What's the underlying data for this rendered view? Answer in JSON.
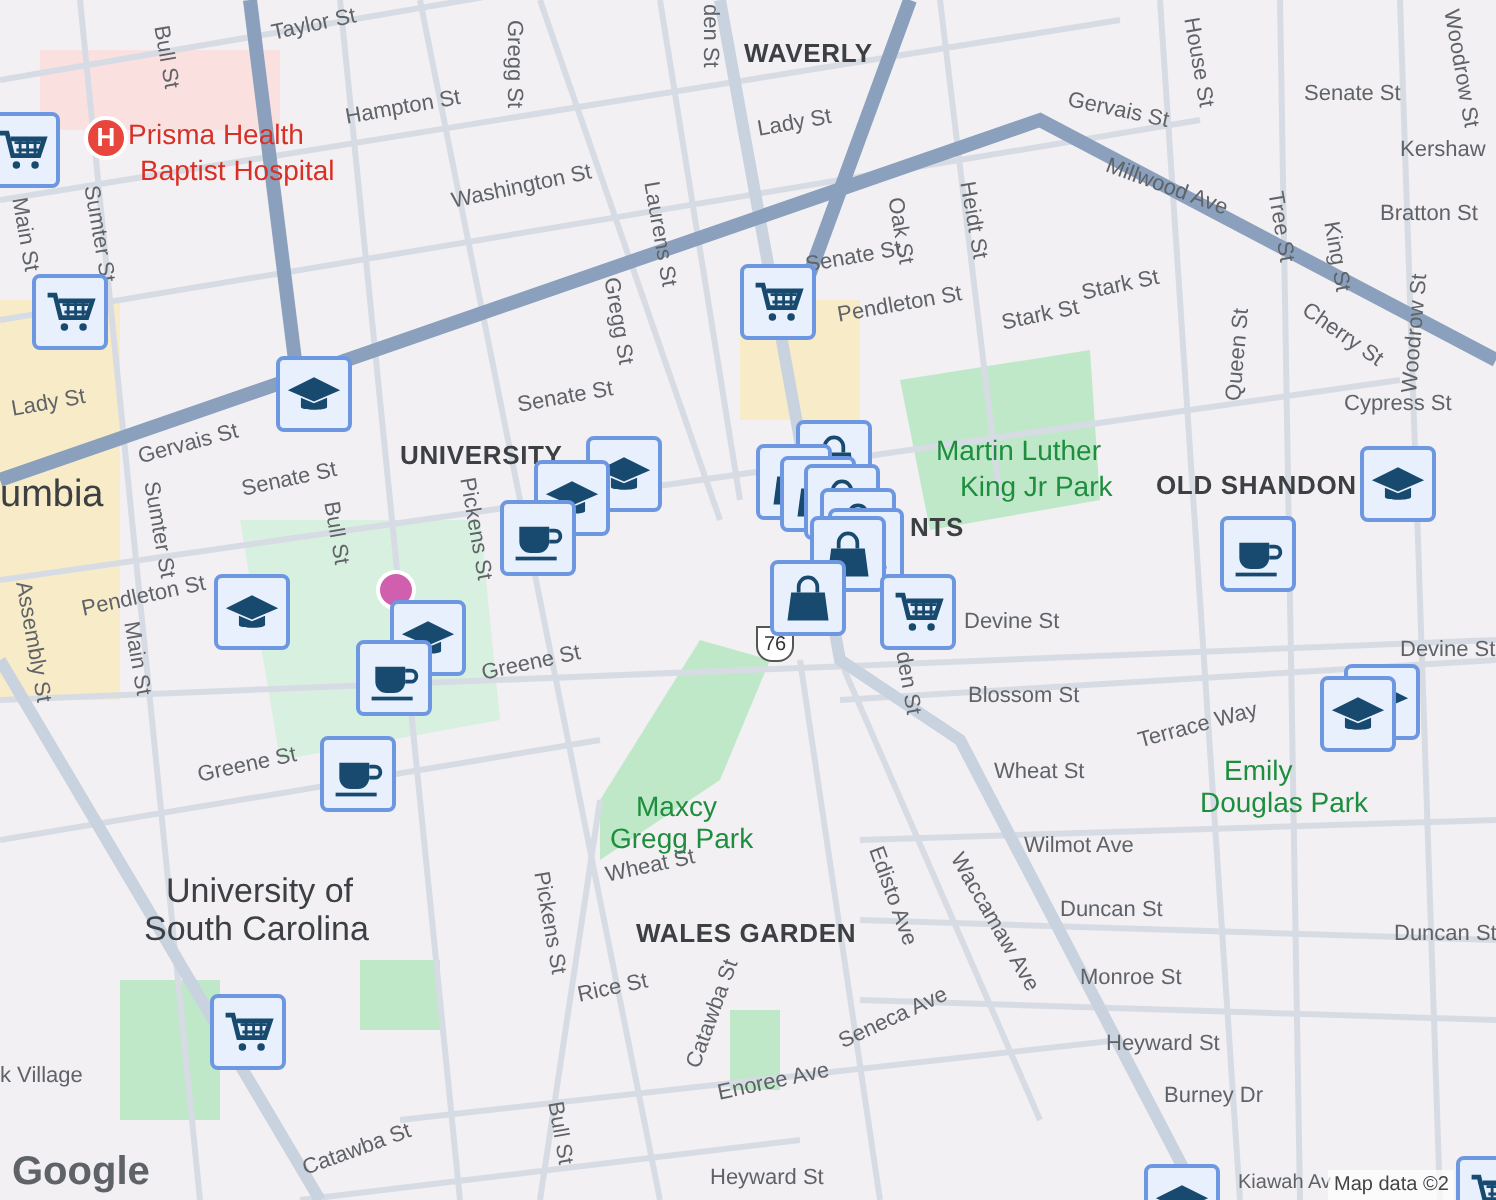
{
  "map": {
    "labels": [
      {
        "text": "Taylor St",
        "kind": "street"
      },
      {
        "text": "Gregg St",
        "kind": "street"
      },
      {
        "text": "Bull St",
        "kind": "street"
      },
      {
        "text": "WAVERLY",
        "kind": "area"
      },
      {
        "text": "den St",
        "kind": "street"
      },
      {
        "text": "Gervais St",
        "kind": "street"
      },
      {
        "text": "Senate St",
        "kind": "street"
      },
      {
        "text": "Woodrow St",
        "kind": "street"
      },
      {
        "text": "Kershaw",
        "kind": "street"
      },
      {
        "text": "Prisma Health",
        "kind": "poi"
      },
      {
        "text": "Baptist Hospital",
        "kind": "poi"
      },
      {
        "text": "Hampton St",
        "kind": "street"
      },
      {
        "text": "Washington St",
        "kind": "street"
      },
      {
        "text": "Lady St",
        "kind": "street"
      },
      {
        "text": "Millwood Ave",
        "kind": "street"
      },
      {
        "text": "Bratton St",
        "kind": "street"
      },
      {
        "text": "Laurens St",
        "kind": "street"
      },
      {
        "text": "Oak St",
        "kind": "street"
      },
      {
        "text": "Heidt St",
        "kind": "street"
      },
      {
        "text": "House St",
        "kind": "street"
      },
      {
        "text": "Tree St",
        "kind": "street"
      },
      {
        "text": "King St",
        "kind": "street"
      },
      {
        "text": "Senate St",
        "kind": "street"
      },
      {
        "text": "Pendleton St",
        "kind": "street"
      },
      {
        "text": "Stark St",
        "kind": "street"
      },
      {
        "text": "Stark St",
        "kind": "street"
      },
      {
        "text": "Cherry St",
        "kind": "street"
      },
      {
        "text": "Gregg St",
        "kind": "street"
      },
      {
        "text": "Main St",
        "kind": "street"
      },
      {
        "text": "Sumter St",
        "kind": "street"
      },
      {
        "text": "Lady St",
        "kind": "street"
      },
      {
        "text": "Gervais St",
        "kind": "street"
      },
      {
        "text": "Senate St",
        "kind": "street"
      },
      {
        "text": "Cypress St",
        "kind": "street"
      },
      {
        "text": "Queen St",
        "kind": "street"
      },
      {
        "text": "Woodrow St",
        "kind": "street"
      },
      {
        "text": "umbia",
        "kind": "city"
      },
      {
        "text": "UNIVERSITY",
        "kind": "area"
      },
      {
        "text": "Martin Luther",
        "kind": "park"
      },
      {
        "text": "King Jr Park",
        "kind": "park"
      },
      {
        "text": "OLD SHANDON",
        "kind": "area"
      },
      {
        "text": "Senate St",
        "kind": "street"
      },
      {
        "text": "Bull St",
        "kind": "street"
      },
      {
        "text": "Pickens St",
        "kind": "street"
      },
      {
        "text": "Sumter St",
        "kind": "street"
      },
      {
        "text": "Assembly St",
        "kind": "street"
      },
      {
        "text": "Pendleton St",
        "kind": "street"
      },
      {
        "text": "Main St",
        "kind": "street"
      },
      {
        "text": "Greene St",
        "kind": "street"
      },
      {
        "text": "Devine St",
        "kind": "street"
      },
      {
        "text": "Devine St",
        "kind": "street"
      },
      {
        "text": "Blossom St",
        "kind": "street"
      },
      {
        "text": "Terrace Way",
        "kind": "street"
      },
      {
        "text": "Wheat St",
        "kind": "street"
      },
      {
        "text": "Emily",
        "kind": "park"
      },
      {
        "text": "Douglas Park",
        "kind": "park"
      },
      {
        "text": "Greene St",
        "kind": "street"
      },
      {
        "text": "Maxcy",
        "kind": "park"
      },
      {
        "text": "Gregg Park",
        "kind": "park"
      },
      {
        "text": "Wheat St",
        "kind": "street"
      },
      {
        "text": "Pickens St",
        "kind": "street"
      },
      {
        "text": "University of",
        "kind": "campus"
      },
      {
        "text": "South Carolina",
        "kind": "campus"
      },
      {
        "text": "Wilmot Ave",
        "kind": "street"
      },
      {
        "text": "Edisto Ave",
        "kind": "street"
      },
      {
        "text": "Waccamaw Ave",
        "kind": "street"
      },
      {
        "text": "WALES GARDEN",
        "kind": "area"
      },
      {
        "text": "Duncan St",
        "kind": "street"
      },
      {
        "text": "Duncan St",
        "kind": "street"
      },
      {
        "text": "Monroe St",
        "kind": "street"
      },
      {
        "text": "Rice St",
        "kind": "street"
      },
      {
        "text": "Catawba St",
        "kind": "street"
      },
      {
        "text": "Seneca Ave",
        "kind": "street"
      },
      {
        "text": "Heyward St",
        "kind": "street"
      },
      {
        "text": "Enoree Ave",
        "kind": "street"
      },
      {
        "text": "Burney Dr",
        "kind": "street"
      },
      {
        "text": "Heyward St",
        "kind": "street"
      },
      {
        "text": "Kiawah Av",
        "kind": "street"
      },
      {
        "text": "k Village",
        "kind": "street"
      },
      {
        "text": "Catawba St",
        "kind": "street"
      },
      {
        "text": "NTS",
        "kind": "area"
      },
      {
        "text": "den St",
        "kind": "street"
      },
      {
        "text": "Bull St",
        "kind": "street"
      }
    ],
    "hospital_marker": {
      "glyph": "H"
    },
    "route_shield": "76",
    "markers": [
      {
        "kind": "cart"
      },
      {
        "kind": "cart"
      },
      {
        "kind": "cart"
      },
      {
        "kind": "grad"
      },
      {
        "kind": "grad"
      },
      {
        "kind": "grad"
      },
      {
        "kind": "cup"
      },
      {
        "kind": "grad"
      },
      {
        "kind": "grad"
      },
      {
        "kind": "cup"
      },
      {
        "kind": "cup"
      },
      {
        "kind": "bag"
      },
      {
        "kind": "bag"
      },
      {
        "kind": "bag"
      },
      {
        "kind": "bag"
      },
      {
        "kind": "bag"
      },
      {
        "kind": "bag"
      },
      {
        "kind": "bag"
      },
      {
        "kind": "bag"
      },
      {
        "kind": "cart"
      },
      {
        "kind": "cup"
      },
      {
        "kind": "grad"
      },
      {
        "kind": "grad"
      },
      {
        "kind": "grad"
      },
      {
        "kind": "cart"
      },
      {
        "kind": "grad"
      },
      {
        "kind": "cart"
      }
    ],
    "logo": "Google",
    "attribution": "Map data ©2"
  }
}
